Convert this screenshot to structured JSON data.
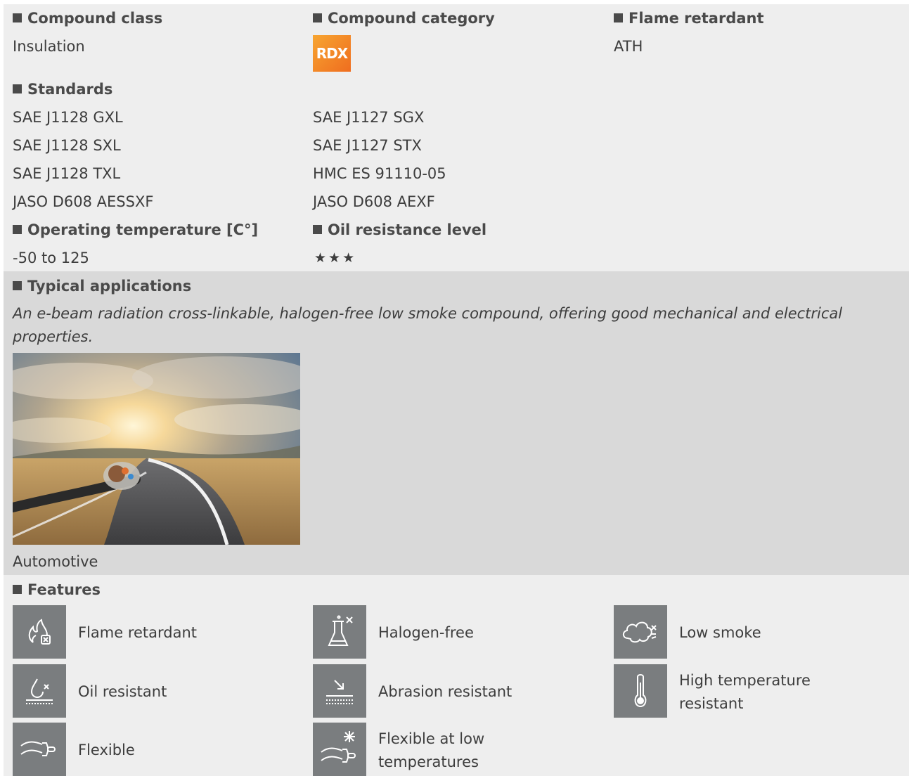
{
  "props": {
    "compound_class": {
      "label": "Compound class",
      "value": "Insulation"
    },
    "compound_category": {
      "label": "Compound category",
      "badge": "RDX"
    },
    "flame_retardant": {
      "label": "Flame retardant",
      "value": "ATH"
    },
    "standards": {
      "label": "Standards",
      "items": [
        "SAE J1128 GXL",
        "SAE J1127 SGX",
        "SAE J1128 SXL",
        "SAE J1127 STX",
        "SAE J1128 TXL",
        "HMC ES 91110-05",
        "JASO D608 AESSXF",
        "JASO D608 AEXF"
      ]
    },
    "operating_temperature": {
      "label": "Operating temperature [C°]",
      "value": "-50 to 125"
    },
    "oil_resistance": {
      "label": "Oil resistance level",
      "stars": "★★★",
      "rating": 3
    }
  },
  "applications": {
    "label": "Typical applications",
    "description": "An e-beam radiation cross-linkable, halogen-free low smoke compound, offering good mechanical and electrical properties.",
    "image_caption": "Automotive"
  },
  "features": {
    "label": "Features",
    "items": [
      {
        "label": "Flame retardant",
        "icon": "flame-icon"
      },
      {
        "label": "Halogen-free",
        "icon": "flask-icon"
      },
      {
        "label": "Low smoke",
        "icon": "smoke-cloud-icon"
      },
      {
        "label": "Oil resistant",
        "icon": "oil-drop-icon"
      },
      {
        "label": "Abrasion resistant",
        "icon": "abrasion-icon"
      },
      {
        "label": "High temperature resistant",
        "icon": "thermometer-icon"
      },
      {
        "label": "Flexible",
        "icon": "flexible-cable-icon"
      },
      {
        "label": "Flexible at low temperatures",
        "icon": "snowflake-cable-icon"
      }
    ]
  },
  "colors": {
    "band_light": "#eeeeee",
    "band_dark": "#d9d9d9",
    "icon_bg": "#7a7d7f",
    "badge_from": "#f7a531",
    "badge_to": "#ef6d1f"
  }
}
